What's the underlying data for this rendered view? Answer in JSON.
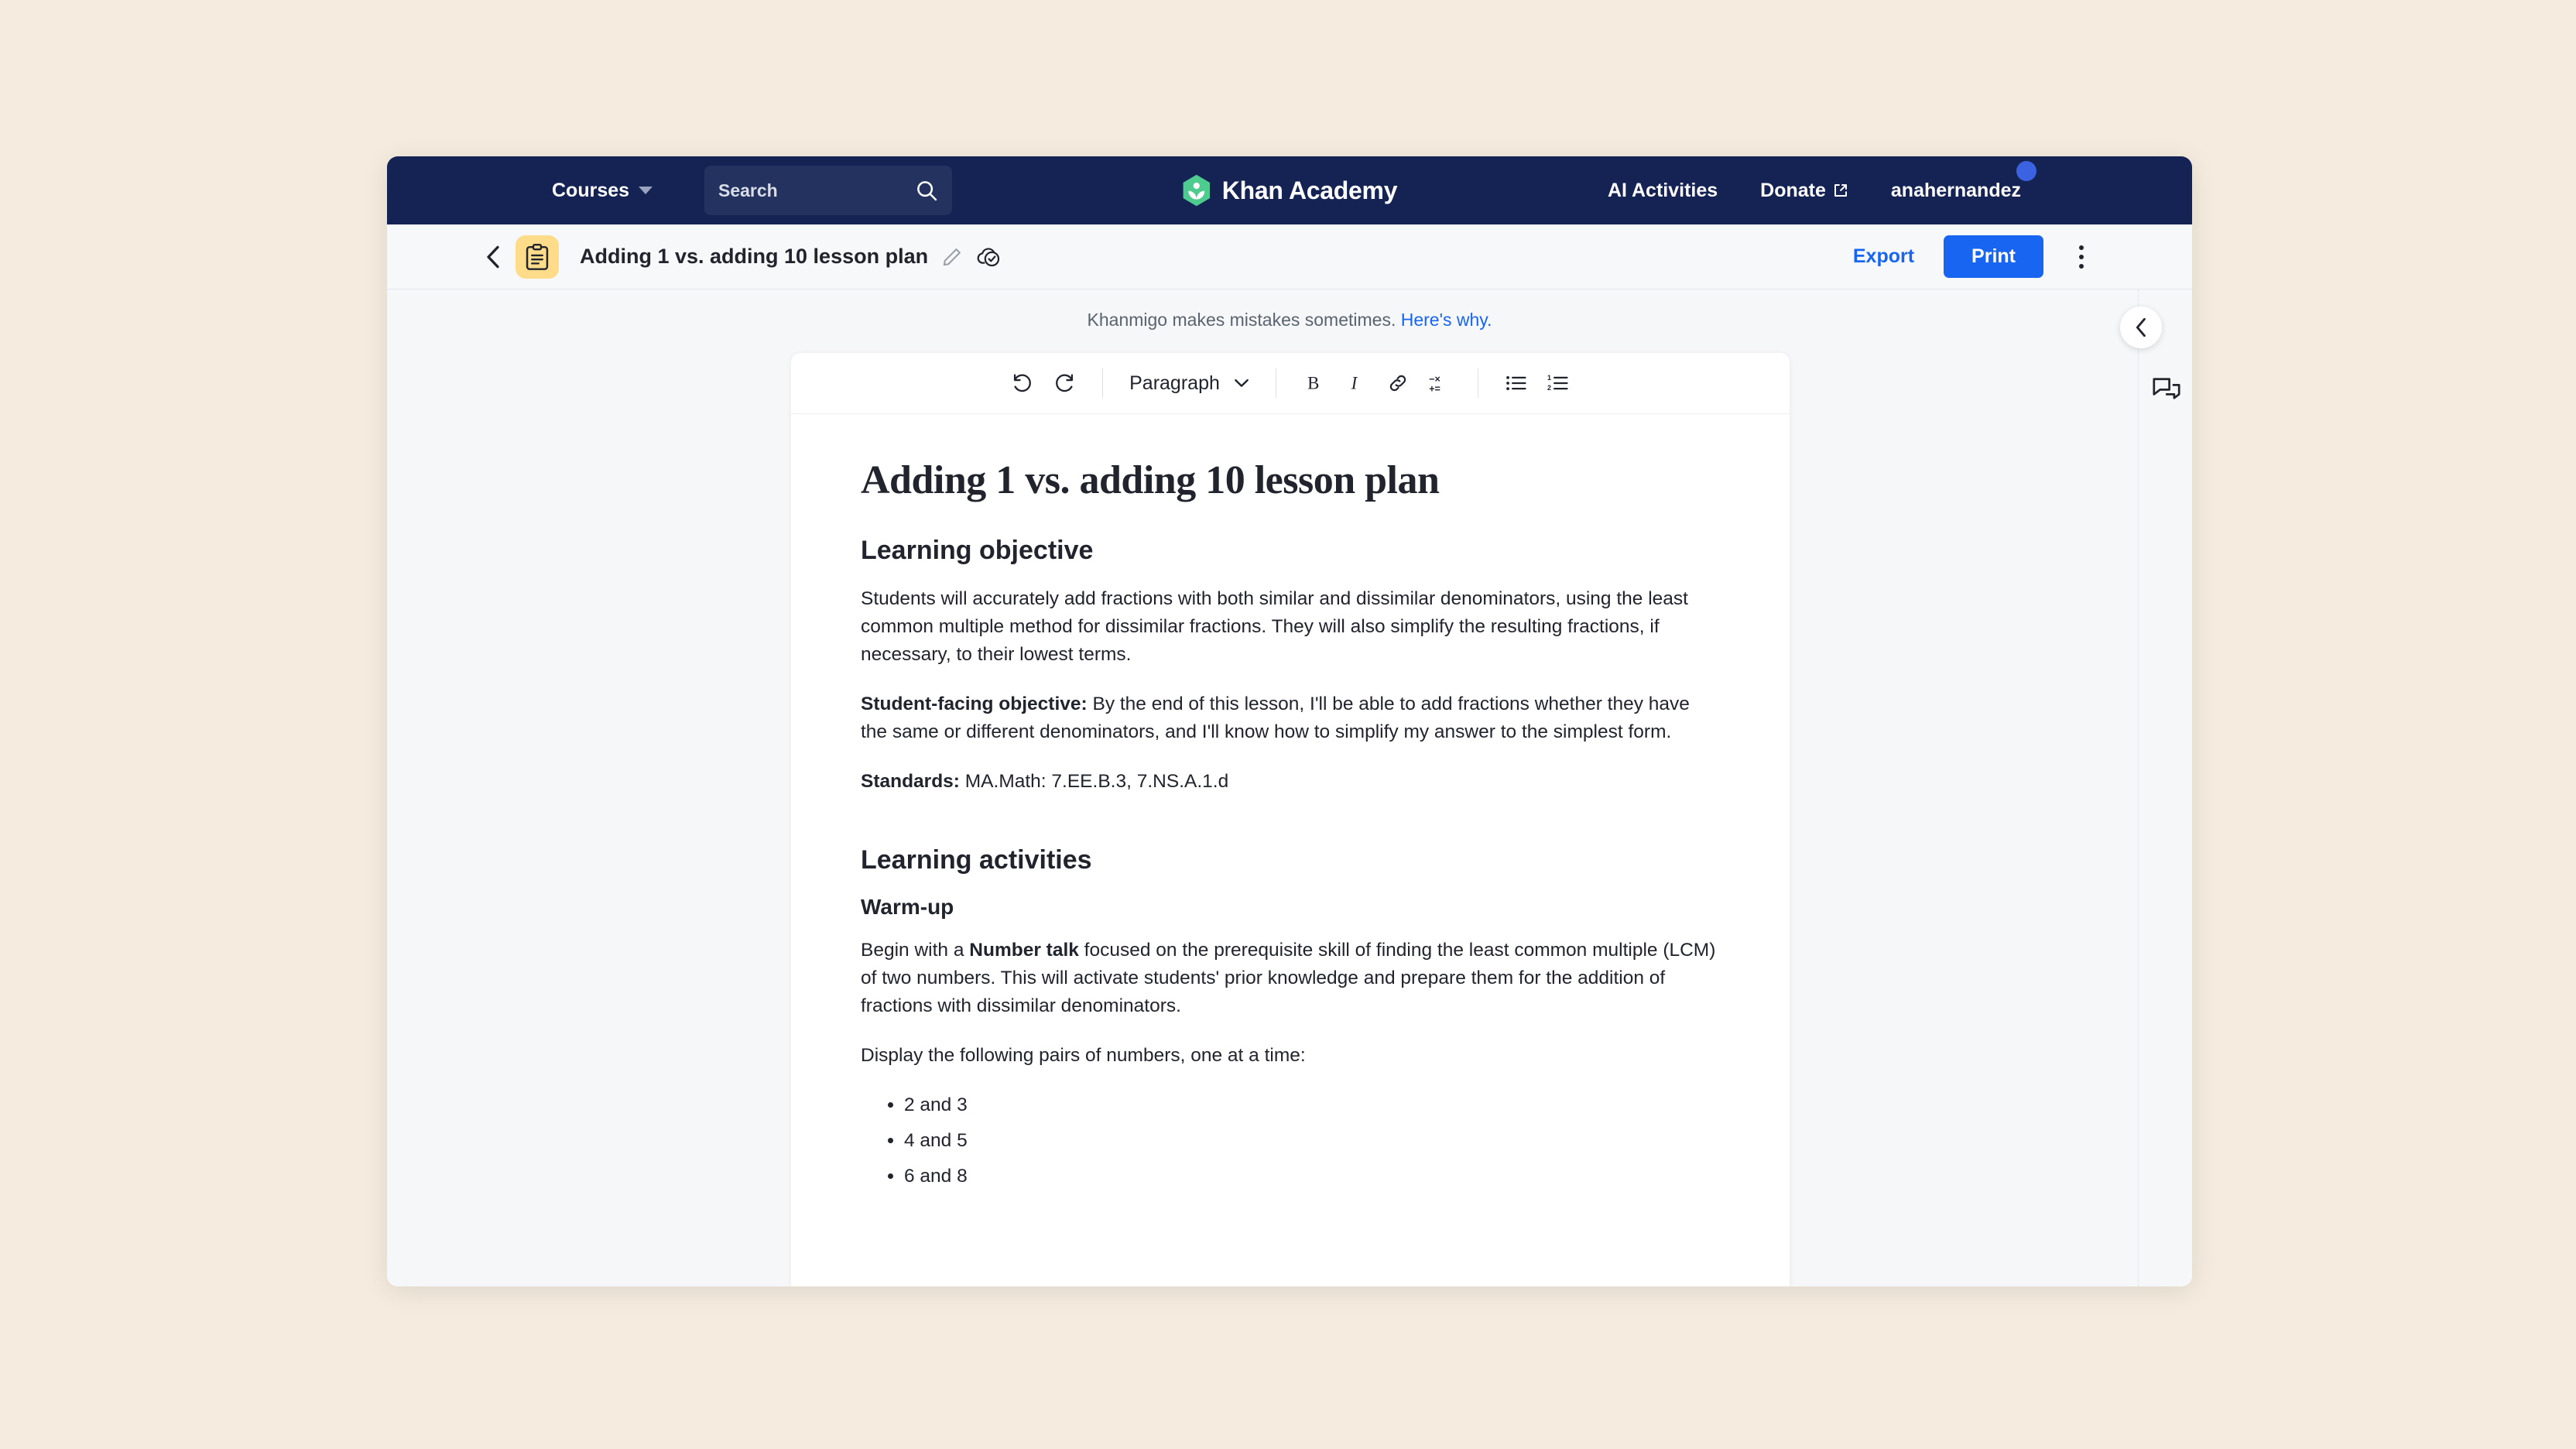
{
  "navbar": {
    "courses_label": "Courses",
    "courses_caret_icon": "caret-down-icon",
    "search_placeholder": "Search",
    "search_icon": "search-icon",
    "logo_icon": "khan-academy-leaf-icon",
    "logo_wordmark": "Khan Academy",
    "ai_activities_label": "AI Activities",
    "donate_label": "Donate",
    "donate_external_icon": "external-link-icon",
    "username": "anahernandez",
    "avatar_dot_color": "#3b62e0",
    "background_color": "#152354"
  },
  "doc_bar": {
    "back_icon": "chevron-left-icon",
    "doc_type_icon": "clipboard-icon",
    "doc_type_badge_color": "#ffdc8a",
    "title": "Adding 1 vs. adding 10 lesson plan",
    "edit_icon": "pencil-icon",
    "save_status_icon": "cloud-check-icon",
    "export_label": "Export",
    "print_label": "Print",
    "more_icon": "kebab-menu-icon",
    "accent_color": "#1865f2"
  },
  "disclaimer": {
    "text": "Khanmigo makes mistakes sometimes.",
    "link_label": "Here's why."
  },
  "format_toolbar": {
    "undo_icon": "undo-icon",
    "redo_icon": "redo-icon",
    "block_style_label": "Paragraph",
    "block_style_caret_icon": "chevron-down-icon",
    "bold_label": "B",
    "italic_label": "I",
    "link_icon": "link-icon",
    "math_icon": "math-equation-icon",
    "bullet_list_icon": "bulleted-list-icon",
    "numbered_list_icon": "numbered-list-icon"
  },
  "document": {
    "title": "Adding 1 vs. adding 10 lesson plan",
    "section_objective_heading": "Learning objective",
    "objective_paragraph": "Students will accurately add fractions with both similar and dissimilar denominators, using the least common multiple method for dissimilar fractions. They will also simplify the resulting fractions, if necessary, to their lowest terms.",
    "student_facing_label": "Student-facing objective:",
    "student_facing_text": " By the end of this lesson, I'll be able to add fractions whether they have the same or different denominators, and I'll know how to simplify my answer to the simplest form.",
    "standards_label": "Standards:",
    "standards_text": " MA.Math: 7.EE.B.3, 7.NS.A.1.d",
    "section_activities_heading": "Learning activities",
    "warmup_heading": "Warm-up",
    "warmup_lead": "Begin with a ",
    "warmup_bold": "Number talk",
    "warmup_rest": " focused on the prerequisite skill of finding the least common multiple (LCM) of two numbers. This will activate students' prior knowledge and prepare them for the addition of fractions with dissimilar denominators.",
    "display_instruction": "Display the following pairs of numbers, one at a time:",
    "number_pairs": [
      "2 and 3",
      "4 and 5",
      "6 and 8"
    ]
  },
  "right_rail": {
    "collapse_icon": "chevron-left-icon",
    "chat_icon": "comments-icon"
  }
}
